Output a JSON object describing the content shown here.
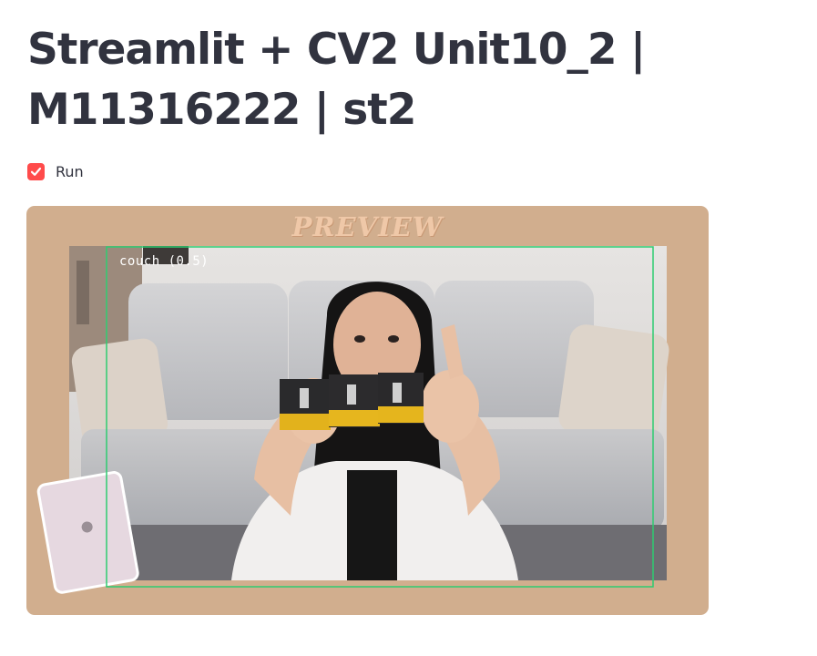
{
  "app": {
    "title": "Streamlit + CV2 Unit10_2 | M11316222 | st2"
  },
  "controls": {
    "run_checkbox": {
      "label": "Run",
      "checked": true,
      "color": "#ff4b4b"
    }
  },
  "video": {
    "overlay_title": "PREVIEW",
    "detection": {
      "label": "couch (0.5)",
      "box_color": "#2ecc71"
    },
    "frame_color": "#d1ae8e"
  }
}
